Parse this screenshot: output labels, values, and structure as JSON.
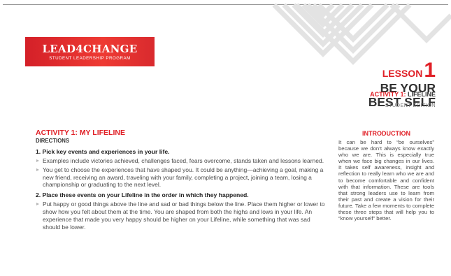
{
  "logo": {
    "title": "LEAD4CHANGE",
    "subtitle": "STUDENT LEADERSHIP PROGRAM"
  },
  "lesson": {
    "word": "LESSON",
    "number": "1",
    "title_lines": [
      "BE YOUR",
      "BEST SELF"
    ]
  },
  "activity_tag": {
    "prefix": "ACTIVITY 1:",
    "name": "LIFELINE"
  },
  "edition": "STUDENT EDITION",
  "main": {
    "heading": "ACTIVITY 1: MY LIFELINE",
    "directions": "DIRECTIONS",
    "steps": [
      {
        "title": "1. Pick key events and experiences in your life.",
        "bullets": [
          "Examples include victories achieved, challenges faced, fears overcome, stands taken and lessons learned.",
          "You get to choose the experiences that have shaped you. It could be anything—achieving a goal, making a new friend, receiving an award, traveling with your family, completing a project, joining a team, losing a championship or graduating to the next level."
        ]
      },
      {
        "title": "2. Place these events on your Lifeline in the order in which they happened.",
        "bullets": [
          "Put happy or good things above the line and sad or bad things below the line. Place them higher or lower to show how you felt about them at the time. You are shaped from both the highs and lows in your life. An experience that made you very happy should be higher on your Lifeline, while something that was sad should be lower."
        ]
      }
    ]
  },
  "intro": {
    "heading": "INTRODUCTION",
    "body": "It can be hard to “be ourselves” because we don’t always know exactly who we are. This is especially true when we face big changes in our lives. It takes self awareness, insight and reflection to really learn who we are and to become comfortable and confident with that information. These are tools that strong leaders use to learn from their past and create a vision for their future. Take a few moments to complete these three steps that will help you to “know yourself” better."
  },
  "colors": {
    "accent": "#e01f26",
    "text": "#3a3a3a",
    "chevron": "#e2e2e2"
  }
}
